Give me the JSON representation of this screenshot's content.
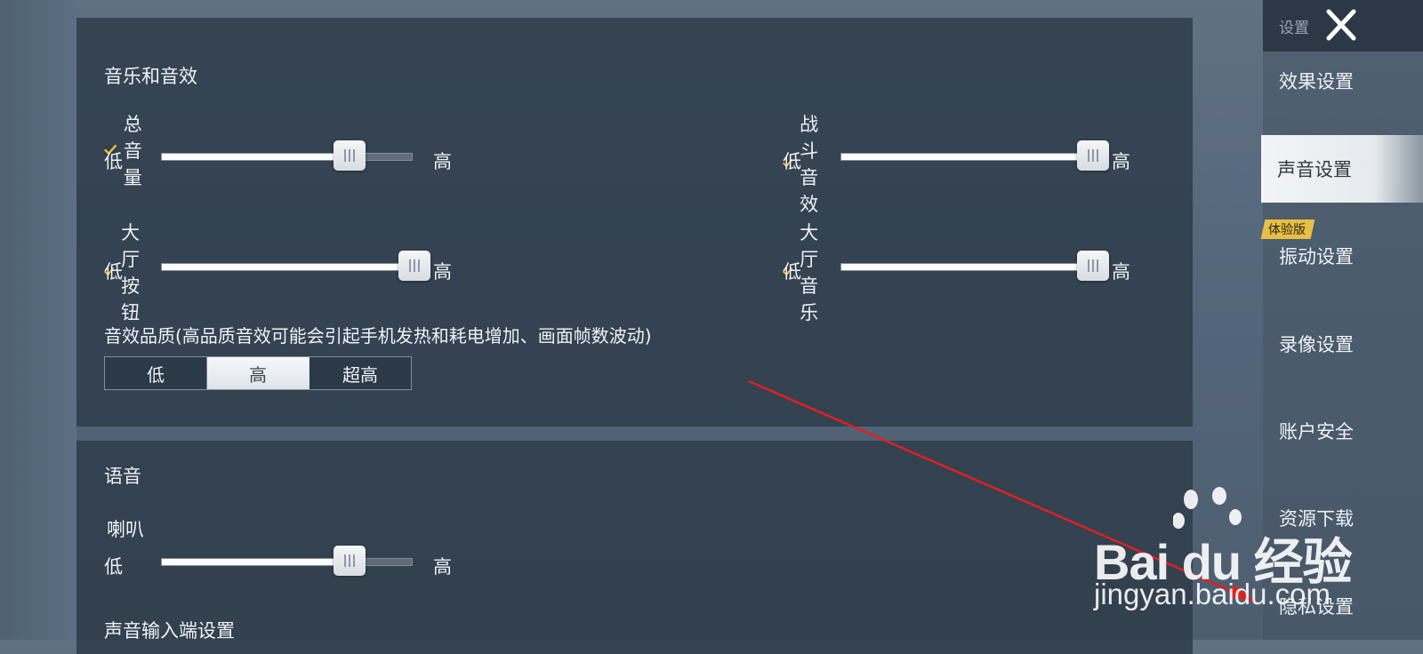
{
  "sidebar": {
    "header_title": "设置",
    "items": [
      {
        "label": "效果设置",
        "active": false
      },
      {
        "label": "声音设置",
        "active": true
      },
      {
        "label": "振动设置",
        "active": false
      },
      {
        "label": "录像设置",
        "active": false
      },
      {
        "label": "账户安全",
        "active": false
      },
      {
        "label": "资源下载",
        "active": false
      },
      {
        "label": "隐私设置",
        "active": false
      }
    ],
    "trial_badge": "体验版"
  },
  "music_sfx": {
    "title": "音乐和音效",
    "master_volume": {
      "label": "总音量",
      "checked": true,
      "level": 0.75
    },
    "battle_sfx": {
      "label": "战斗音效",
      "checked": true,
      "level": 1.0
    },
    "lobby_button": {
      "label": "大厅按钮",
      "checked": true,
      "level": 1.0
    },
    "lobby_music": {
      "label": "大厅音乐",
      "checked": true,
      "level": 1.0
    },
    "low_label": "低",
    "high_label": "高",
    "quality_desc": "音效品质(高品质音效可能会引起手机发热和耗电增加、画面帧数波动)",
    "quality_options": [
      "低",
      "高",
      "超高"
    ],
    "quality_selected": "高"
  },
  "voice": {
    "title": "语音",
    "speaker": {
      "label": "喇叭",
      "level": 0.75
    },
    "input_title": "声音输入端设置"
  },
  "watermark": {
    "brand": "Bai du 经验",
    "url": "jingyan.baidu.com"
  },
  "colors": {
    "accent_check": "#e9b23c",
    "annotation_arrow": "#e02020"
  }
}
